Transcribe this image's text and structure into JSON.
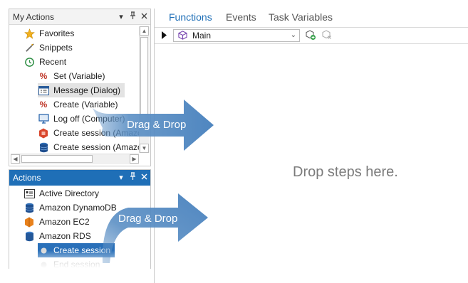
{
  "my_actions": {
    "title": "My Actions",
    "items": [
      {
        "label": "Favorites",
        "icon": "star-icon"
      },
      {
        "label": "Snippets",
        "icon": "snippet-icon"
      },
      {
        "label": "Recent",
        "icon": "recent-icon"
      },
      {
        "label": "Set (Variable)",
        "icon": "variable-icon"
      },
      {
        "label": "Message (Dialog)",
        "icon": "dialog-icon"
      },
      {
        "label": "Create (Variable)",
        "icon": "variable-icon"
      },
      {
        "label": "Log off (Computer)",
        "icon": "computer-icon"
      },
      {
        "label": "Create session (Amazo",
        "icon": "amazon-ec2-icon"
      },
      {
        "label": "Create session (Amazo",
        "icon": "amazon-dynamodb-icon"
      }
    ]
  },
  "actions": {
    "title": "Actions",
    "items": [
      {
        "label": "Active Directory",
        "icon": "active-directory-icon"
      },
      {
        "label": "Amazon DynamoDB",
        "icon": "amazon-dynamodb-icon"
      },
      {
        "label": "Amazon EC2",
        "icon": "amazon-ec2-icon"
      },
      {
        "label": "Amazon RDS",
        "icon": "amazon-rds-icon"
      },
      {
        "label": "Create session",
        "icon": "bullet-icon"
      },
      {
        "label": "End session",
        "icon": "bullet-icon"
      }
    ]
  },
  "tabs": [
    "Functions",
    "Events",
    "Task Variables"
  ],
  "function_selector": {
    "value": "Main"
  },
  "canvas": {
    "placeholder": "Drop steps here."
  },
  "drag_hints": [
    "Drag & Drop",
    "Drag & Drop"
  ],
  "colors": {
    "accent": "#1f6fb7",
    "arrow": "#5b8fc4",
    "selection": "#2a70b9"
  }
}
